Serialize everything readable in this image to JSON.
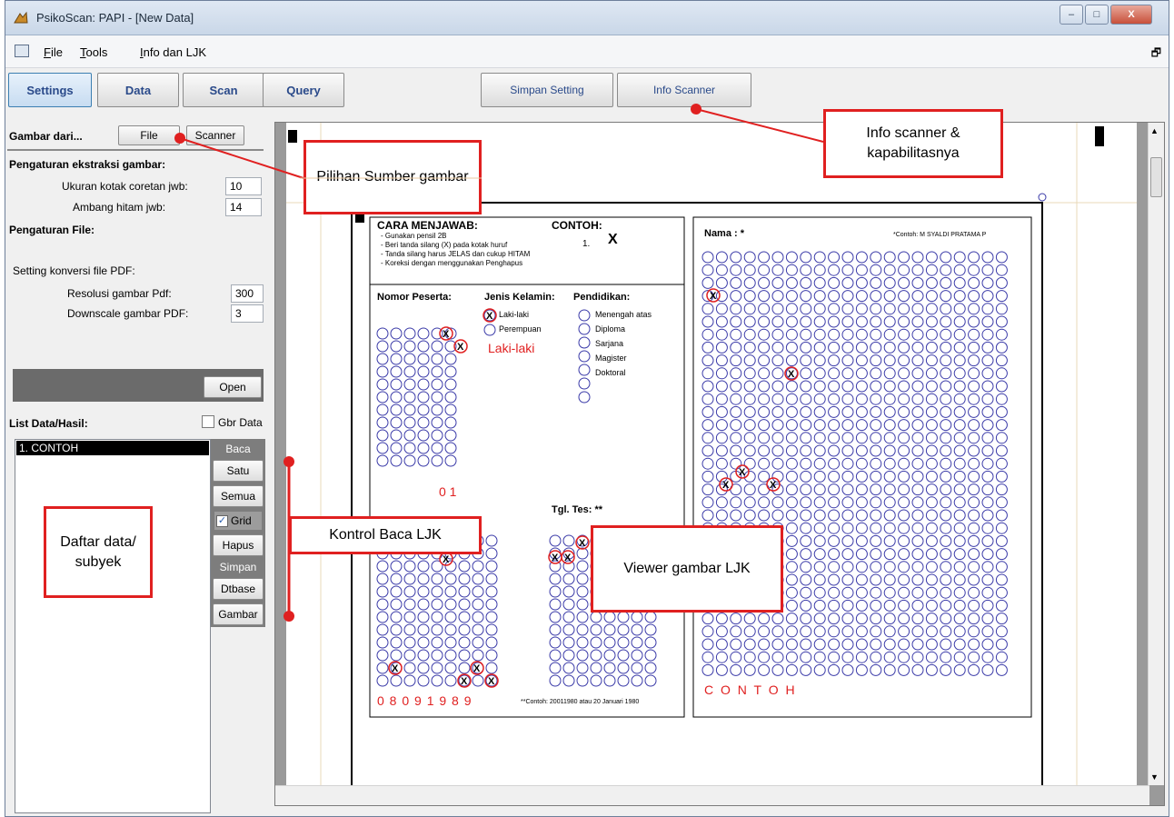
{
  "window": {
    "title": "PsikoScan: PAPI - [New Data]",
    "minimize": "–",
    "maximize": "□",
    "close": "X"
  },
  "menu": {
    "items": [
      {
        "u": "F",
        "rest": "ile"
      },
      {
        "u": "T",
        "rest": "ools"
      },
      {
        "u": "I",
        "rest": "nfo dan LJK"
      }
    ]
  },
  "toolbar": {
    "tabs": [
      "Settings",
      "Data",
      "Scan",
      "Query"
    ],
    "simpan_setting": "Simpan Setting",
    "info_scanner": "Info Scanner"
  },
  "settings": {
    "gambar_dari": "Gambar dari...",
    "file_btn": "File",
    "scanner_btn": "Scanner",
    "ekstraksi_title": "Pengaturan ekstraksi gambar:",
    "ukuran_label": "Ukuran kotak coretan jwb:",
    "ukuran_value": "10",
    "ambang_label": "Ambang hitam jwb:",
    "ambang_value": "14",
    "file_title": "Pengaturan File:",
    "pdf_title": "Setting konversi file PDF:",
    "resolusi_label": "Resolusi gambar Pdf:",
    "resolusi_value": "300",
    "downscale_label": "Downscale gambar PDF:",
    "downscale_value": "3",
    "open_btn": "Open"
  },
  "list": {
    "title": "List Data/Hasil:",
    "gbr_data": "Gbr Data",
    "items": [
      "1. CONTOH"
    ],
    "baca": "Baca",
    "satu": "Satu",
    "semua": "Semua",
    "grid": "Grid",
    "grid_checked": true,
    "hapus": "Hapus",
    "simpan": "Simpan",
    "dtbase": "Dtbase",
    "gambar": "Gambar"
  },
  "sheet": {
    "cara": "CARA MENJAWAB:",
    "contoh_head": "CONTOH:",
    "contoh_mark": "1.",
    "instr": [
      "- Gunakan pensil 2B",
      "- Beri tanda silang (X) pada kotak huruf",
      "- Tanda silang harus JELAS dan cukup HITAM",
      "- Koreksi dengan menggunakan Penghapus"
    ],
    "nomor": "Nomor Peserta:",
    "jenis": "Jenis Kelamin:",
    "pendidikan": "Pendidikan:",
    "jk_opts": [
      "Laki-laki",
      "Perempuan"
    ],
    "jk_result": "Laki-laki",
    "pend_opts": [
      "Menengah atas",
      "Diploma",
      "Sarjana",
      "Magister",
      "Doktoral"
    ],
    "nomor_result": "0 1",
    "tgl": "Tgl. Tes: **",
    "tanggal_result": "0 8 0 9 1 9 8 9",
    "tanggal_note": "**Contoh: 20011980 atau 20 Januari 1980",
    "nama": "Nama : *",
    "nama_note": "*Contoh: M SYALDI PRATAMA P",
    "nama_result": "C O N T O H"
  },
  "callouts": {
    "sumber": "Pilihan Sumber gambar",
    "info": "Info scanner & kapabilitasnya",
    "daftar": "Daftar data/ subyek",
    "kontrol": "Kontrol Baca LJK",
    "viewer": "Viewer gambar LJK"
  },
  "colors": {
    "callout_border": "#e02020",
    "bubble": "#3a3aa8",
    "mark_red": "#e02020"
  }
}
